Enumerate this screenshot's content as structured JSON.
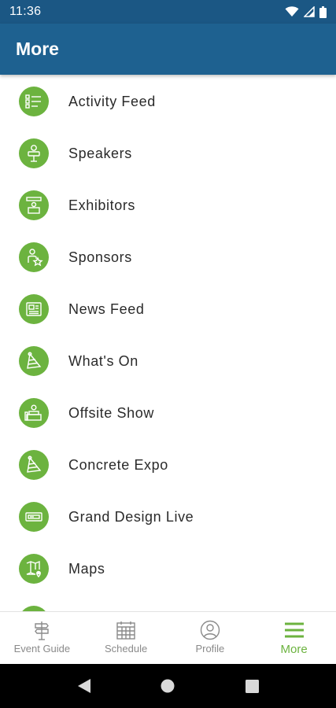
{
  "status_bar": {
    "time": "11:36"
  },
  "header": {
    "title": "More"
  },
  "menu": {
    "items": [
      {
        "label": "Activity Feed",
        "icon": "list-icon"
      },
      {
        "label": "Speakers",
        "icon": "speaker-icon"
      },
      {
        "label": "Exhibitors",
        "icon": "exhibitor-icon"
      },
      {
        "label": "Sponsors",
        "icon": "sponsor-icon"
      },
      {
        "label": "News Feed",
        "icon": "newspaper-icon"
      },
      {
        "label": "What's On",
        "icon": "party-hat-icon"
      },
      {
        "label": "Offsite Show",
        "icon": "offsite-icon"
      },
      {
        "label": "Concrete Expo",
        "icon": "party-hat-icon"
      },
      {
        "label": "Grand Design Live",
        "icon": "ticket-icon"
      },
      {
        "label": "Maps",
        "icon": "map-icon"
      }
    ]
  },
  "bottom_nav": {
    "tabs": [
      {
        "label": "Event Guide",
        "icon": "signpost-icon"
      },
      {
        "label": "Schedule",
        "icon": "calendar-icon"
      },
      {
        "label": "Profile",
        "icon": "profile-icon"
      },
      {
        "label": "More",
        "icon": "hamburger-icon"
      }
    ],
    "active": "More"
  },
  "colors": {
    "status_bar": "#1b5784",
    "app_bar": "#1e6190",
    "accent_green": "#6cb33f",
    "inactive_gray": "#8a8a8a"
  }
}
